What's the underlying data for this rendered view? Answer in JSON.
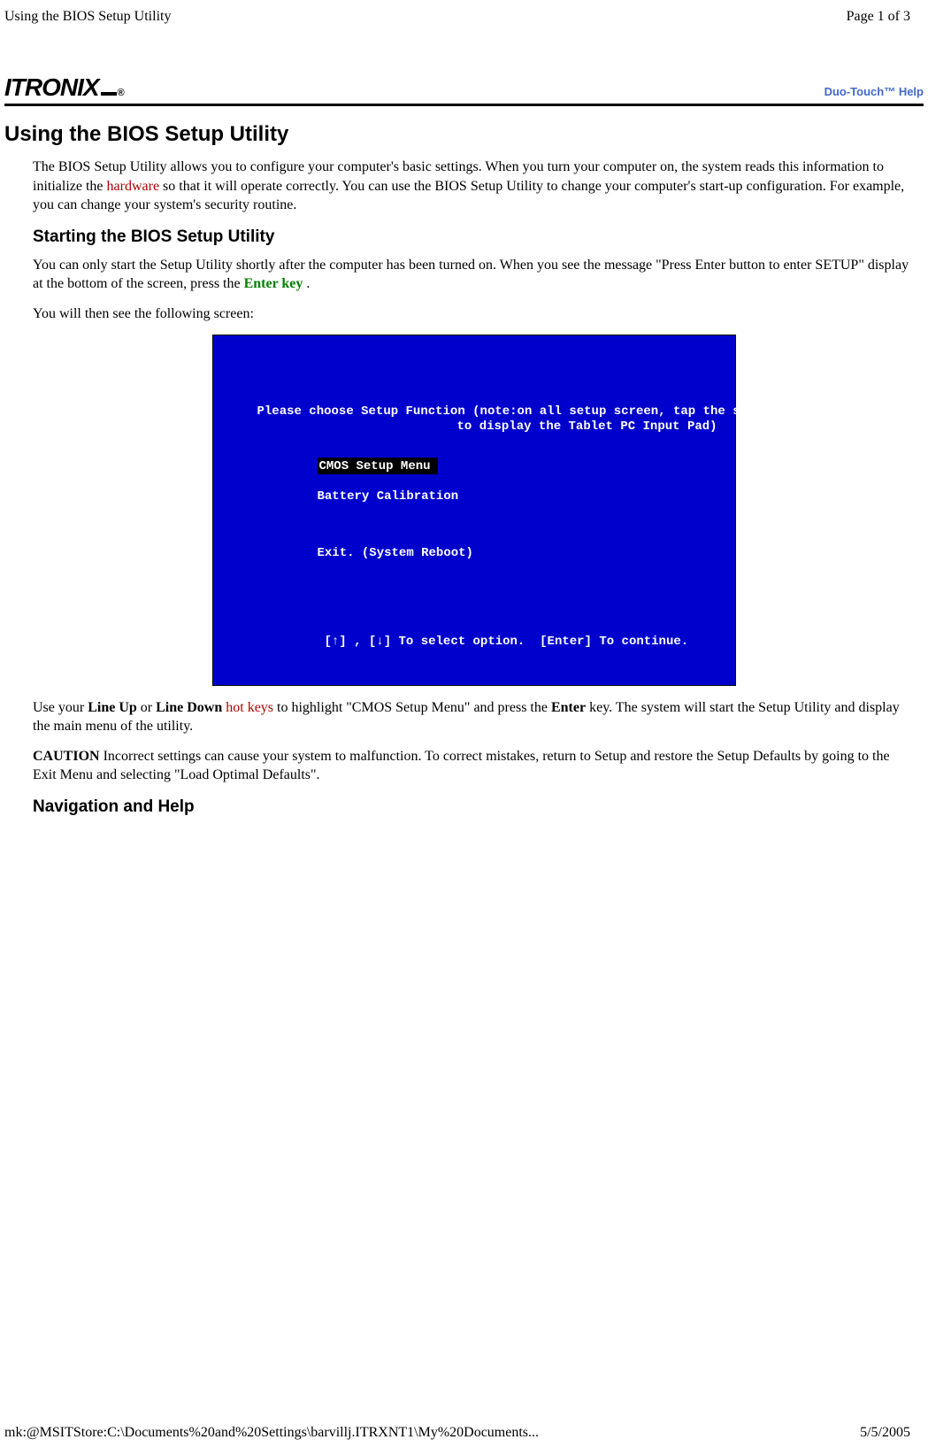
{
  "header": {
    "title": "Using the BIOS Setup Utility",
    "page_indicator": "Page 1 of 3"
  },
  "brand": {
    "name": "ITRONIX",
    "help_label": "Duo-Touch™ Help"
  },
  "main_title": "Using the BIOS Setup Utility",
  "intro_p1a": "The BIOS Setup Utility allows you to configure your computer's basic settings. When you turn your computer on, the system reads this information to initialize the ",
  "intro_link1": "hardware",
  "intro_p1b": " so that it will operate correctly. You can use the BIOS Setup Utility to change your computer's start-up configuration. For example, you can change your system's security routine.",
  "section1_title": "Starting the BIOS Setup Utility",
  "section1_p1a": "You can only start the Setup Utility shortly after the computer has been turned on. When you see the message \"Press Enter button to enter  SETUP\" display at the bottom of the screen, press the ",
  "section1_link1": "Enter key",
  "section1_p1b": " .",
  "section1_p2": "You will then see the following screen:",
  "bios": {
    "line1": "Please choose Setup Function (note:on all setup screen, tap the screen",
    "line2": "to display the Tablet PC Input Pad)",
    "opt1": "CMOS Setup Menu",
    "opt2": "Battery Calibration",
    "opt3": "Exit. (System Reboot)",
    "footer": "[↑] , [↓] To select option.  [Enter] To continue."
  },
  "after_bios_p1a": "Use your ",
  "after_bios_b1": "Line Up",
  "after_bios_p1b": " or ",
  "after_bios_b2": "Line Down",
  "after_bios_p1c": " ",
  "after_bios_link1": "hot keys",
  "after_bios_p1d": " to highlight \"CMOS Setup Menu\" and press the ",
  "after_bios_b3": "Enter",
  "after_bios_p1e": " key.  The system will start the Setup Utility and display the main menu of the utility.",
  "caution_label": "CAUTION",
  "caution_text": "  Incorrect settings can cause your system to malfunction.  To correct mistakes, return to Setup and restore the Setup Defaults by going to the Exit Menu and selecting \"Load Optimal Defaults\".",
  "section2_title": "Navigation and Help",
  "footer": {
    "path": "mk:@MSITStore:C:\\Documents%20and%20Settings\\barvillj.ITRXNT1\\My%20Documents...",
    "date": "5/5/2005"
  }
}
